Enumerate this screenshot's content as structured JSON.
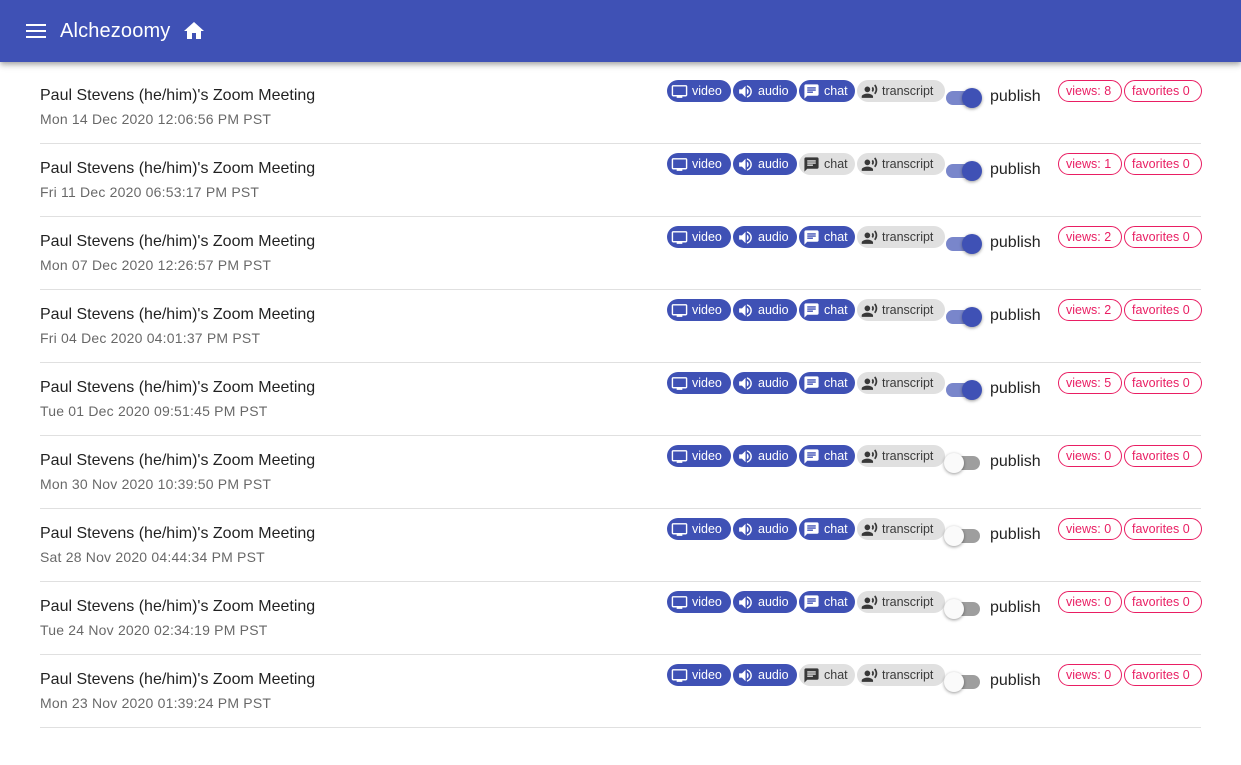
{
  "app": {
    "title": "Alchezoomy"
  },
  "colors": {
    "primary": "#3f51b5",
    "accent": "#e91e63",
    "chip_off": "#e0e0e0"
  },
  "icons": {
    "menu": "menu-icon",
    "home": "home-icon",
    "video": "monitor-icon",
    "audio": "volume-icon",
    "chat": "chat-bubble-icon",
    "transcript": "record-voice-icon"
  },
  "labels": {
    "video": "video",
    "audio": "audio",
    "chat": "chat",
    "transcript": "transcript",
    "publish": "publish",
    "views": "views:",
    "favorites": "favorites"
  },
  "meetings": [
    {
      "title": "Paul Stevens (he/him)'s Zoom Meeting",
      "date": "Mon 14 Dec 2020 12:06:56 PM PST",
      "video": true,
      "audio": true,
      "chat": true,
      "transcript": false,
      "published": true,
      "views": 8,
      "favorites": 0
    },
    {
      "title": "Paul Stevens (he/him)'s Zoom Meeting",
      "date": "Fri 11 Dec 2020 06:53:17 PM PST",
      "video": true,
      "audio": true,
      "chat": false,
      "transcript": false,
      "published": true,
      "views": 1,
      "favorites": 0
    },
    {
      "title": "Paul Stevens (he/him)'s Zoom Meeting",
      "date": "Mon 07 Dec 2020 12:26:57 PM PST",
      "video": true,
      "audio": true,
      "chat": true,
      "transcript": false,
      "published": true,
      "views": 2,
      "favorites": 0
    },
    {
      "title": "Paul Stevens (he/him)'s Zoom Meeting",
      "date": "Fri 04 Dec 2020 04:01:37 PM PST",
      "video": true,
      "audio": true,
      "chat": true,
      "transcript": false,
      "published": true,
      "views": 2,
      "favorites": 0
    },
    {
      "title": "Paul Stevens (he/him)'s Zoom Meeting",
      "date": "Tue 01 Dec 2020 09:51:45 PM PST",
      "video": true,
      "audio": true,
      "chat": true,
      "transcript": false,
      "published": true,
      "views": 5,
      "favorites": 0
    },
    {
      "title": "Paul Stevens (he/him)'s Zoom Meeting",
      "date": "Mon 30 Nov 2020 10:39:50 PM PST",
      "video": true,
      "audio": true,
      "chat": true,
      "transcript": false,
      "published": false,
      "views": 0,
      "favorites": 0
    },
    {
      "title": "Paul Stevens (he/him)'s Zoom Meeting",
      "date": "Sat 28 Nov 2020 04:44:34 PM PST",
      "video": true,
      "audio": true,
      "chat": true,
      "transcript": false,
      "published": false,
      "views": 0,
      "favorites": 0
    },
    {
      "title": "Paul Stevens (he/him)'s Zoom Meeting",
      "date": "Tue 24 Nov 2020 02:34:19 PM PST",
      "video": true,
      "audio": true,
      "chat": true,
      "transcript": false,
      "published": false,
      "views": 0,
      "favorites": 0
    },
    {
      "title": "Paul Stevens (he/him)'s Zoom Meeting",
      "date": "Mon 23 Nov 2020 01:39:24 PM PST",
      "video": true,
      "audio": true,
      "chat": false,
      "transcript": false,
      "published": false,
      "views": 0,
      "favorites": 0
    }
  ]
}
